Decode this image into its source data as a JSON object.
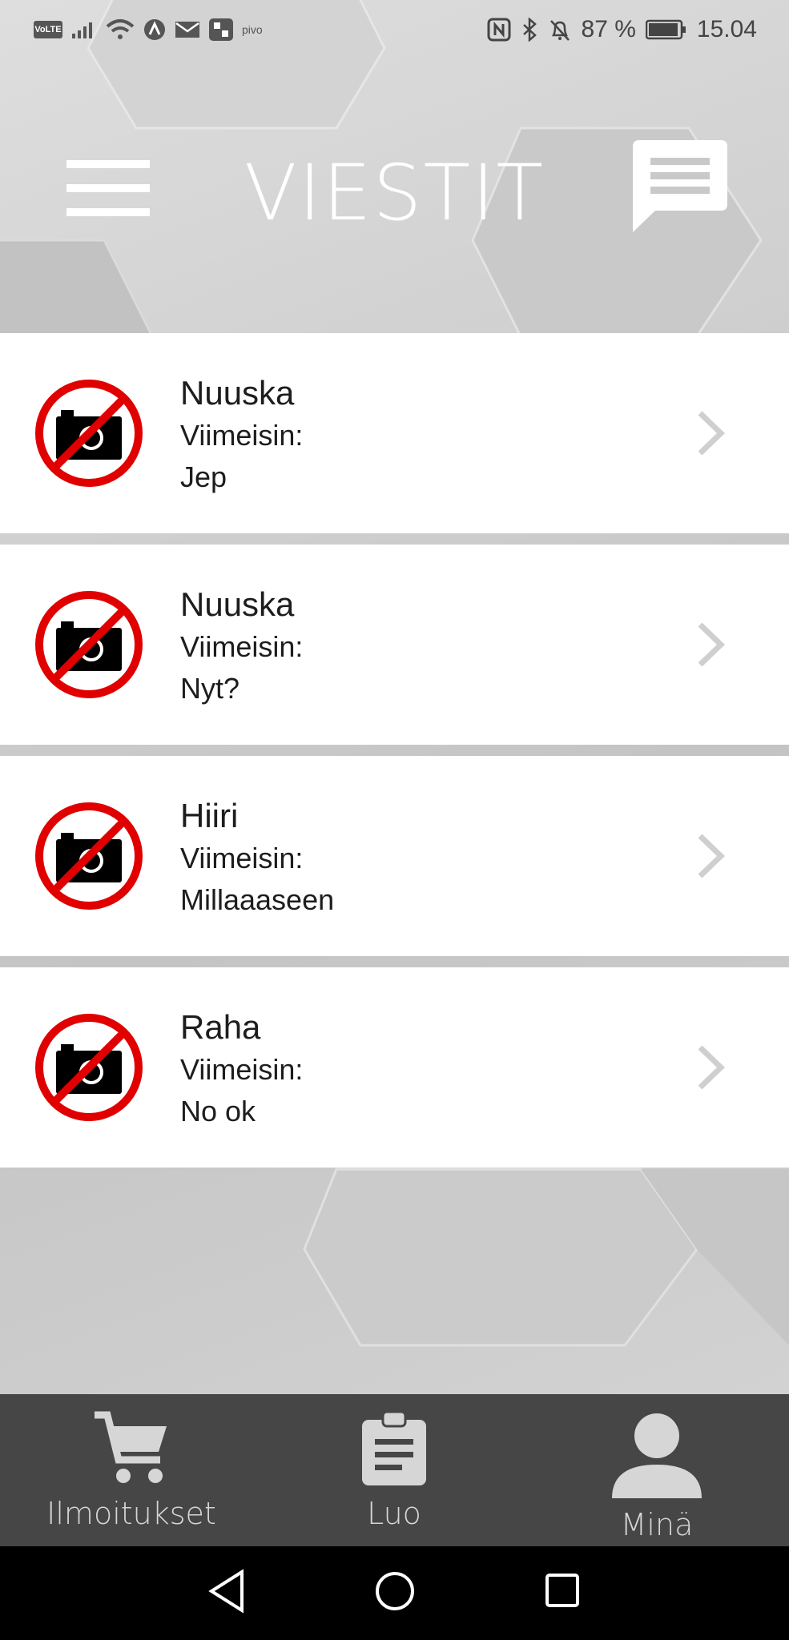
{
  "status_bar": {
    "volte": "VoLTE",
    "carrier_app": "pivo",
    "battery": "87 %",
    "time": "15.04"
  },
  "header": {
    "title": "VIESTIT",
    "menu_icon": "hamburger-menu-icon",
    "chat_icon": "chat-bubble-icon"
  },
  "conversations": [
    {
      "name": "Nuuska",
      "latest_label": "Viimeisin:",
      "latest": "Jep",
      "avatar_icon": "no-photo-icon"
    },
    {
      "name": "Nuuska",
      "latest_label": "Viimeisin:",
      "latest": "Nyt?",
      "avatar_icon": "no-photo-icon"
    },
    {
      "name": "Hiiri",
      "latest_label": "Viimeisin:",
      "latest": "Millaaaseen",
      "avatar_icon": "no-photo-icon"
    },
    {
      "name": "Raha",
      "latest_label": "Viimeisin:",
      "latest": "No ok",
      "avatar_icon": "no-photo-icon"
    }
  ],
  "bottom_nav": [
    {
      "label": "Ilmoitukset",
      "icon": "cart-icon"
    },
    {
      "label": "Luo",
      "icon": "clipboard-icon"
    },
    {
      "label": "Minä",
      "icon": "person-icon"
    }
  ],
  "colors": {
    "avatar_ring": "#e00000",
    "nav_bg": "#464646",
    "row_bg": "#ffffff"
  }
}
